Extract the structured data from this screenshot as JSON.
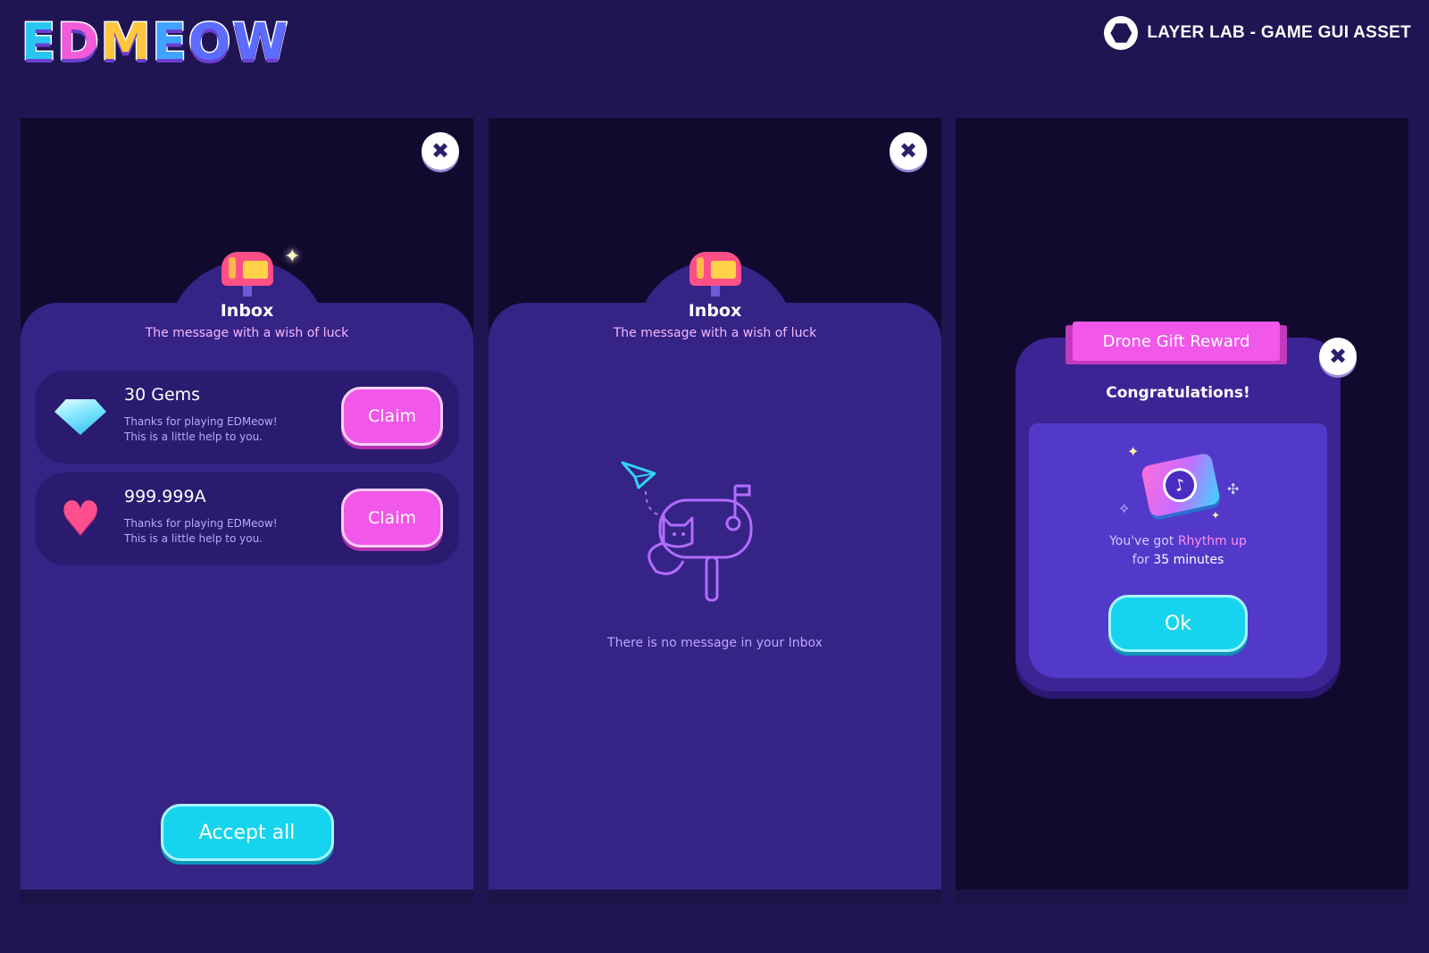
{
  "header": {
    "logo_letters": [
      {
        "char": "E",
        "color": "#28c7f2"
      },
      {
        "char": "D",
        "color": "#f25bd9"
      },
      {
        "char": "M",
        "color": "#ffc53d"
      },
      {
        "char": "E",
        "color": "#3fa3ff"
      },
      {
        "char": "O",
        "color": "#5b6cff"
      },
      {
        "char": "W",
        "color": "#5b6cff"
      }
    ],
    "brand_label": "LAYER LAB - GAME GUI ASSET"
  },
  "inbox_panel": {
    "close_icon": "✖",
    "title": "Inbox",
    "subtitle": "The message with a wish of luck",
    "messages": [
      {
        "icon": "gem-icon",
        "title": "30 Gems",
        "line1": "Thanks for playing EDMeow!",
        "line2": "This is a little help to you.",
        "claim_label": "Claim"
      },
      {
        "icon": "heart-icon",
        "title": "999.999A",
        "line1": "Thanks for playing EDMeow!",
        "line2": "This is a little help to you.",
        "claim_label": "Claim"
      }
    ],
    "accept_all_label": "Accept all"
  },
  "empty_panel": {
    "close_icon": "✖",
    "title": "Inbox",
    "subtitle": "The message with a wish of luck",
    "empty_text": "There is no message in your Inbox"
  },
  "reward_panel": {
    "close_icon": "✖",
    "ribbon_label": "Drone Gift Reward",
    "congrats": "Congratulations!",
    "line1_prefix": "You've got ",
    "line1_highlight": "Rhythm up",
    "line2_prefix": "for ",
    "line2_highlight": "35 minutes",
    "ok_label": "Ok"
  },
  "colors": {
    "background": "#1f1553",
    "sheet": "#362386",
    "claim_pink": "#f157e8",
    "accept_cyan": "#17d4ee"
  }
}
